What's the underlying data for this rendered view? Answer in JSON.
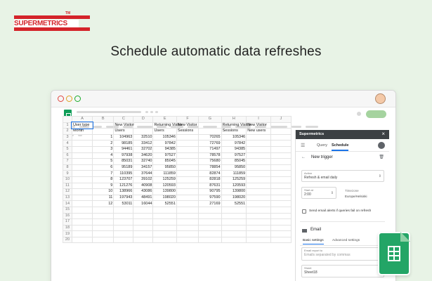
{
  "brand": {
    "logo_text": "SUPERMETRICS",
    "tm": "TM",
    "color": "#d4232a"
  },
  "headline": "Schedule automatic data refreshes",
  "sheet": {
    "columns": [
      "A",
      "B",
      "C",
      "D",
      "E",
      "F",
      "G",
      "H",
      "I",
      "J"
    ],
    "rows": [
      [
        "User type",
        "",
        "New Visitor",
        "",
        "Returning Visitor",
        "New Visitor",
        "",
        "Returning Visitor",
        "New Visitor",
        ""
      ],
      [
        "Month",
        "",
        "Users",
        "",
        "Users",
        "Sessions",
        "",
        "Sessions",
        "New users",
        ""
      ],
      [
        "",
        "1",
        "104963",
        "32510",
        "105346",
        "",
        "70265",
        "105346",
        "",
        ""
      ],
      [
        "",
        "2",
        "98185",
        "33412",
        "97842",
        "",
        "72769",
        "97842",
        "",
        ""
      ],
      [
        "",
        "3",
        "94461",
        "32702",
        "94385",
        "",
        "71497",
        "94385",
        "",
        ""
      ],
      [
        "",
        "4",
        "97938",
        "34620",
        "97527",
        "",
        "78578",
        "97527",
        "",
        ""
      ],
      [
        "",
        "5",
        "85031",
        "32740",
        "85045",
        "",
        "75680",
        "85045",
        "",
        ""
      ],
      [
        "",
        "6",
        "95189",
        "34157",
        "95850",
        "",
        "78854",
        "95850",
        "",
        ""
      ],
      [
        "",
        "7",
        "110395",
        "37644",
        "111859",
        "",
        "82874",
        "111859",
        "",
        ""
      ],
      [
        "",
        "8",
        "123707",
        "39102",
        "125259",
        "",
        "82818",
        "125259",
        "",
        ""
      ],
      [
        "",
        "9",
        "121276",
        "40908",
        "120593",
        "",
        "87631",
        "120593",
        "",
        ""
      ],
      [
        "",
        "10",
        "138966",
        "43086",
        "139800",
        "",
        "90795",
        "139800",
        "",
        ""
      ],
      [
        "",
        "11",
        "197943",
        "48491",
        "198020",
        "",
        "97590",
        "198020",
        "",
        ""
      ],
      [
        "",
        "12",
        "53011",
        "16044",
        "52551",
        "",
        "27169",
        "52551",
        "",
        ""
      ],
      [
        "",
        "",
        "",
        "",
        "",
        "",
        "",
        "",
        "",
        ""
      ],
      [
        "",
        "",
        "",
        "",
        "",
        "",
        "",
        "",
        "",
        ""
      ],
      [
        "",
        "",
        "",
        "",
        "",
        "",
        "",
        "",
        "",
        ""
      ],
      [
        "",
        "",
        "",
        "",
        "",
        "",
        "",
        "",
        "",
        ""
      ],
      [
        "",
        "",
        "",
        "",
        "",
        "",
        "",
        "",
        "",
        ""
      ],
      [
        "",
        "",
        "",
        "",
        "",
        "",
        "",
        "",
        "",
        ""
      ]
    ]
  },
  "sidebar": {
    "title": "Supermetrics",
    "close": "×",
    "tabs": [
      "Query",
      "Schedule"
    ],
    "back": "←",
    "trigger_title": "New trigger",
    "trash": "🗑",
    "action_label": "Action",
    "action_value": "Refresh & email daily",
    "start_label": "Start at",
    "start_value": "2:00",
    "timezone_label": "Timezone",
    "timezone_value": "Europe/Helsinki",
    "checkbox_text": "Send email alerts if queries fail on refresh",
    "email_title": "Email",
    "email_tabs": [
      "Basic settings",
      "Advanced settings"
    ],
    "email_report_label": "Email report to",
    "email_report_placeholder": "Emails separated by commas",
    "sheet_label": "Sheet",
    "sheet_value": "Sheet18"
  },
  "colors": {
    "background": "#e8f3e6",
    "sheets_green": "#0f9d58",
    "accent": "#1a73e8"
  },
  "icons": [
    "sheets-icon",
    "menu-icon",
    "user-icon",
    "back-arrow-icon",
    "trash-icon",
    "mail-icon",
    "google-sheets-icon"
  ]
}
